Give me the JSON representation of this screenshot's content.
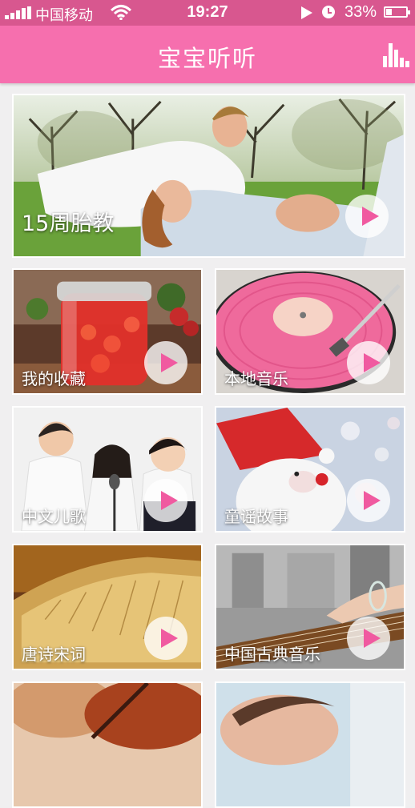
{
  "status_bar": {
    "carrier": "中国移动",
    "time": "19:27",
    "battery": "33%",
    "battery_level": 0.33,
    "icons": [
      "signal-icon",
      "wifi-icon",
      "play-icon",
      "alarm-clock-icon",
      "battery-icon"
    ]
  },
  "header": {
    "title": "宝宝听听",
    "right_icon": "equalizer-bars-icon"
  },
  "featured": {
    "label": "15周胎教",
    "icon": "play-icon"
  },
  "categories": [
    {
      "label": "我的收藏"
    },
    {
      "label": "本地音乐"
    },
    {
      "label": "中文儿歌"
    },
    {
      "label": "童谣故事"
    },
    {
      "label": "唐诗宋词"
    },
    {
      "label": "中国古典音乐"
    }
  ],
  "colors": {
    "status_bar": "#d8578f",
    "nav_bar": "#f66fae",
    "accent": "#f05aa0",
    "background": "#f0eff0"
  }
}
